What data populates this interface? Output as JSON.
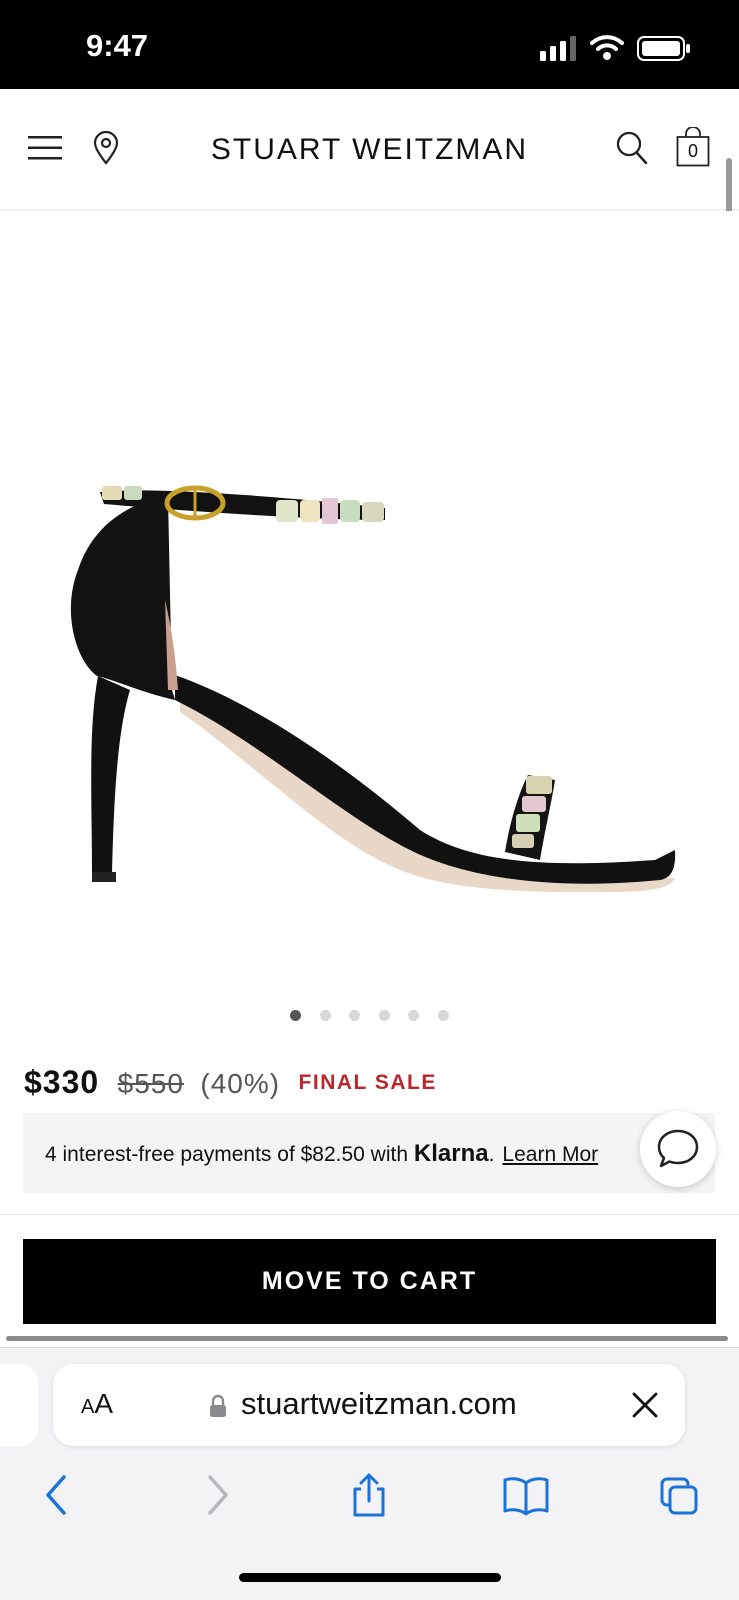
{
  "status_bar": {
    "time": "9:47"
  },
  "header": {
    "brand": "STUART  WEITZMAN",
    "cart_count": "0",
    "icons": [
      "menu-icon",
      "location-pin-icon",
      "search-icon",
      "shopping-bag-icon"
    ]
  },
  "product": {
    "image_alt": "Black suede ankle-strap sandal with jeweled straps",
    "carousel": {
      "total": 6,
      "active": 1
    }
  },
  "price": {
    "current": "$330",
    "original": "$550",
    "discount": "(40%)",
    "sale_label": "FINAL SALE",
    "sale_color": "#b8282c"
  },
  "klarna": {
    "text_before": "4 interest-free payments of $82.50 with ",
    "brand": "Klarna",
    "text_after": ".",
    "learn_more": "Learn Mor"
  },
  "actions": {
    "move_to_cart": "MOVE TO CART"
  },
  "browser": {
    "aa_small": "A",
    "aa_large": "A",
    "url": "stuartweitzman.com",
    "accent_color": "#1a73d9"
  }
}
